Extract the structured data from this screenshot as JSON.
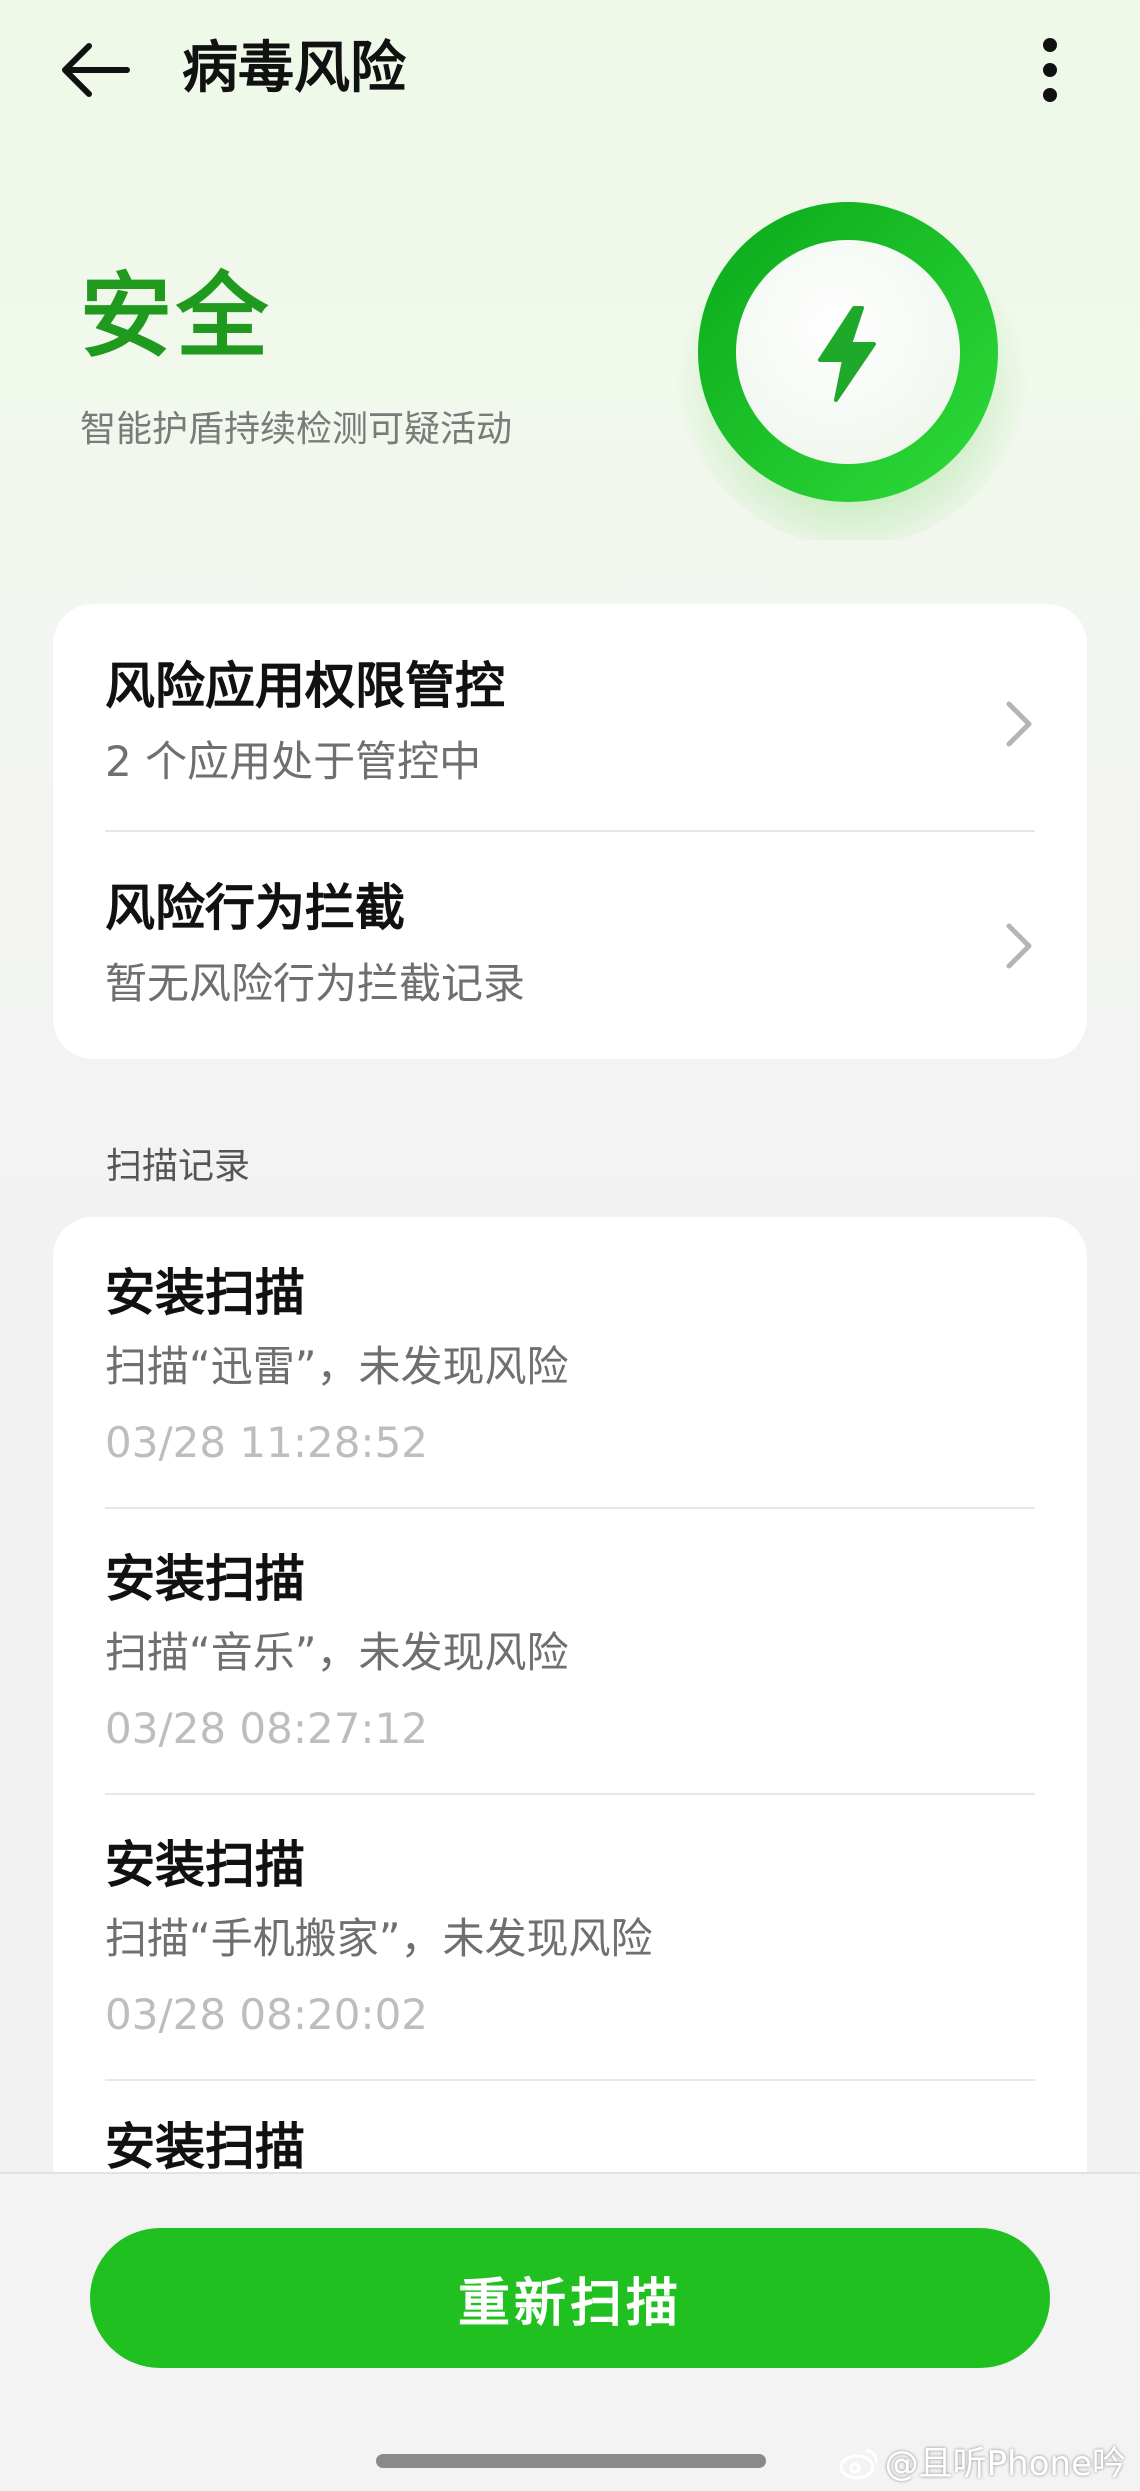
{
  "header": {
    "title": "病毒风险",
    "back_icon": "back-arrow-icon",
    "more_icon": "more-vertical-icon"
  },
  "hero": {
    "status": "安全",
    "subtitle": "智能护盾持续检测可疑活动",
    "icon": "lightning-bolt-icon",
    "accent": "#1f9a1f",
    "ring_color": "#22c22a"
  },
  "risk_items": [
    {
      "title": "风险应用权限管控",
      "subtitle": "2 个应用处于管控中"
    },
    {
      "title": "风险行为拦截",
      "subtitle": "暂无风险行为拦截记录"
    }
  ],
  "scan_section": {
    "label": "扫描记录",
    "items": [
      {
        "title": "安装扫描",
        "desc": "扫描“迅雷”，未发现风险",
        "time": "03/28 11:28:52"
      },
      {
        "title": "安装扫描",
        "desc": "扫描“音乐”，未发现风险",
        "time": "03/28 08:27:12"
      },
      {
        "title": "安装扫描",
        "desc": "扫描“手机搬家”，未发现风险",
        "time": "03/28 08:20:02"
      },
      {
        "title": "安装扫描",
        "desc": "",
        "time": ""
      }
    ]
  },
  "actions": {
    "rescan_label": "重新扫描",
    "button_color": "#20c020"
  },
  "watermark": {
    "text": "@且听Phone吟",
    "icon": "weibo-icon"
  }
}
